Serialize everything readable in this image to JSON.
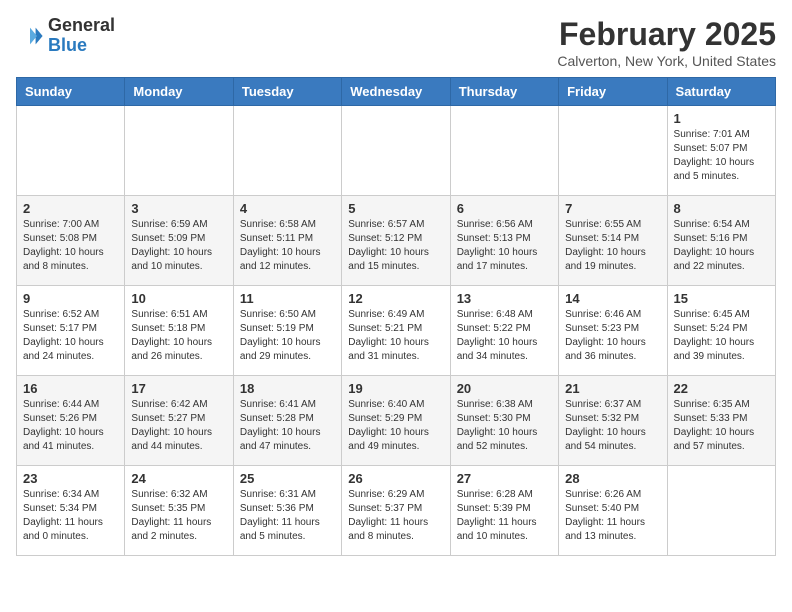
{
  "logo": {
    "general": "General",
    "blue": "Blue"
  },
  "title": "February 2025",
  "location": "Calverton, New York, United States",
  "headers": [
    "Sunday",
    "Monday",
    "Tuesday",
    "Wednesday",
    "Thursday",
    "Friday",
    "Saturday"
  ],
  "weeks": [
    [
      {
        "day": "",
        "info": ""
      },
      {
        "day": "",
        "info": ""
      },
      {
        "day": "",
        "info": ""
      },
      {
        "day": "",
        "info": ""
      },
      {
        "day": "",
        "info": ""
      },
      {
        "day": "",
        "info": ""
      },
      {
        "day": "1",
        "info": "Sunrise: 7:01 AM\nSunset: 5:07 PM\nDaylight: 10 hours and 5 minutes."
      }
    ],
    [
      {
        "day": "2",
        "info": "Sunrise: 7:00 AM\nSunset: 5:08 PM\nDaylight: 10 hours and 8 minutes."
      },
      {
        "day": "3",
        "info": "Sunrise: 6:59 AM\nSunset: 5:09 PM\nDaylight: 10 hours and 10 minutes."
      },
      {
        "day": "4",
        "info": "Sunrise: 6:58 AM\nSunset: 5:11 PM\nDaylight: 10 hours and 12 minutes."
      },
      {
        "day": "5",
        "info": "Sunrise: 6:57 AM\nSunset: 5:12 PM\nDaylight: 10 hours and 15 minutes."
      },
      {
        "day": "6",
        "info": "Sunrise: 6:56 AM\nSunset: 5:13 PM\nDaylight: 10 hours and 17 minutes."
      },
      {
        "day": "7",
        "info": "Sunrise: 6:55 AM\nSunset: 5:14 PM\nDaylight: 10 hours and 19 minutes."
      },
      {
        "day": "8",
        "info": "Sunrise: 6:54 AM\nSunset: 5:16 PM\nDaylight: 10 hours and 22 minutes."
      }
    ],
    [
      {
        "day": "9",
        "info": "Sunrise: 6:52 AM\nSunset: 5:17 PM\nDaylight: 10 hours and 24 minutes."
      },
      {
        "day": "10",
        "info": "Sunrise: 6:51 AM\nSunset: 5:18 PM\nDaylight: 10 hours and 26 minutes."
      },
      {
        "day": "11",
        "info": "Sunrise: 6:50 AM\nSunset: 5:19 PM\nDaylight: 10 hours and 29 minutes."
      },
      {
        "day": "12",
        "info": "Sunrise: 6:49 AM\nSunset: 5:21 PM\nDaylight: 10 hours and 31 minutes."
      },
      {
        "day": "13",
        "info": "Sunrise: 6:48 AM\nSunset: 5:22 PM\nDaylight: 10 hours and 34 minutes."
      },
      {
        "day": "14",
        "info": "Sunrise: 6:46 AM\nSunset: 5:23 PM\nDaylight: 10 hours and 36 minutes."
      },
      {
        "day": "15",
        "info": "Sunrise: 6:45 AM\nSunset: 5:24 PM\nDaylight: 10 hours and 39 minutes."
      }
    ],
    [
      {
        "day": "16",
        "info": "Sunrise: 6:44 AM\nSunset: 5:26 PM\nDaylight: 10 hours and 41 minutes."
      },
      {
        "day": "17",
        "info": "Sunrise: 6:42 AM\nSunset: 5:27 PM\nDaylight: 10 hours and 44 minutes."
      },
      {
        "day": "18",
        "info": "Sunrise: 6:41 AM\nSunset: 5:28 PM\nDaylight: 10 hours and 47 minutes."
      },
      {
        "day": "19",
        "info": "Sunrise: 6:40 AM\nSunset: 5:29 PM\nDaylight: 10 hours and 49 minutes."
      },
      {
        "day": "20",
        "info": "Sunrise: 6:38 AM\nSunset: 5:30 PM\nDaylight: 10 hours and 52 minutes."
      },
      {
        "day": "21",
        "info": "Sunrise: 6:37 AM\nSunset: 5:32 PM\nDaylight: 10 hours and 54 minutes."
      },
      {
        "day": "22",
        "info": "Sunrise: 6:35 AM\nSunset: 5:33 PM\nDaylight: 10 hours and 57 minutes."
      }
    ],
    [
      {
        "day": "23",
        "info": "Sunrise: 6:34 AM\nSunset: 5:34 PM\nDaylight: 11 hours and 0 minutes."
      },
      {
        "day": "24",
        "info": "Sunrise: 6:32 AM\nSunset: 5:35 PM\nDaylight: 11 hours and 2 minutes."
      },
      {
        "day": "25",
        "info": "Sunrise: 6:31 AM\nSunset: 5:36 PM\nDaylight: 11 hours and 5 minutes."
      },
      {
        "day": "26",
        "info": "Sunrise: 6:29 AM\nSunset: 5:37 PM\nDaylight: 11 hours and 8 minutes."
      },
      {
        "day": "27",
        "info": "Sunrise: 6:28 AM\nSunset: 5:39 PM\nDaylight: 11 hours and 10 minutes."
      },
      {
        "day": "28",
        "info": "Sunrise: 6:26 AM\nSunset: 5:40 PM\nDaylight: 11 hours and 13 minutes."
      },
      {
        "day": "",
        "info": ""
      }
    ]
  ]
}
